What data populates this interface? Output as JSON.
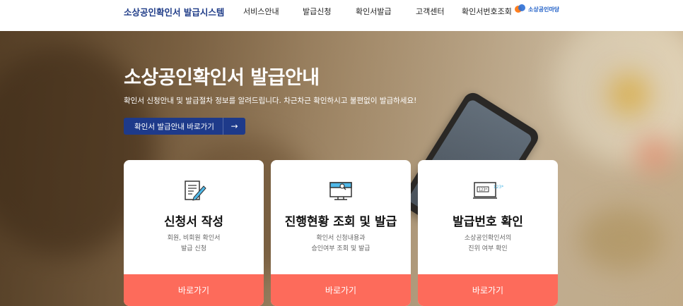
{
  "header": {
    "brand": "소상공인확인서 발급시스템",
    "nav": [
      "서비스안내",
      "발급신청",
      "확인서발급",
      "고객센터",
      "확인서번호조회"
    ],
    "partner_logo_text": "소상공인마당"
  },
  "hero": {
    "title": "소상공인확인서 발급안내",
    "subtitle": "확인서 신청안내 및 발급절차 정보를 알려드립니다. 차근차근 확인하시고 불편없이 발급하세요!",
    "cta_label": "확인서 발급안내 바로가기",
    "cta_arrow": "→"
  },
  "cards": [
    {
      "icon": "document-pen-icon",
      "title": "신청서 작성",
      "desc_line1": "회원, 비회원 확인서",
      "desc_line2": "발급 신청",
      "button": "바로가기"
    },
    {
      "icon": "monitor-search-icon",
      "title": "진행현황 조회 및 발급",
      "desc_line1": "확인서 신청내용과",
      "desc_line2": "승인여부 조회 및 발급",
      "button": "바로가기"
    },
    {
      "icon": "number-screen-icon",
      "title": "발급번호 확인",
      "desc_line1": "소상공인확인서의",
      "desc_line2": "진위 여부 확인",
      "button": "바로가기",
      "icon_text": "123*"
    }
  ],
  "colors": {
    "brand": "#1f3c88",
    "cta": "#1e3a8a",
    "card_button": "#fd6b5b",
    "icon_accent": "#4fb8e8"
  }
}
